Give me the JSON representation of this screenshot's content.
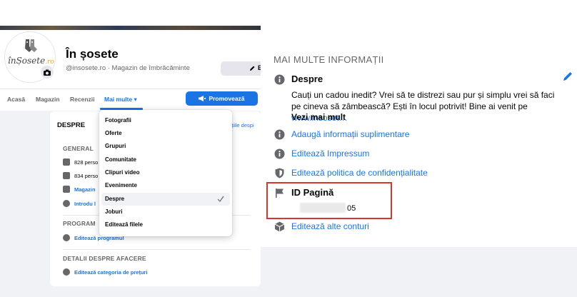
{
  "left": {
    "page": {
      "name": "În șosete",
      "handle": "@insosete.ro · Magazin de îmbrăcăminte",
      "logo_text": "înȘosete",
      "logo_suffix": ".ro",
      "edit_label": "E"
    },
    "tabs": [
      {
        "label": "Acasă"
      },
      {
        "label": "Magazin"
      },
      {
        "label": "Recenzii"
      },
      {
        "label": "Mai multe ▾"
      }
    ],
    "promote_label": "Promovează",
    "about": {
      "title": "DESPRE",
      "right_link": "națiile despi",
      "general_head": "GENERAL",
      "general_rows": [
        {
          "label": "828 perso"
        },
        {
          "label": "834 perso"
        },
        {
          "label": "Magazin",
          "link": true
        },
        {
          "label": "Introdu l",
          "link": true
        }
      ],
      "program_head": "PROGRAM",
      "program_row": "Editează programul",
      "business_head": "DETALII DESPRE AFACERE",
      "business_row": "Editează categoria de prețuri"
    },
    "dropdown": {
      "items": [
        {
          "label": "Fotografii"
        },
        {
          "label": "Oferte"
        },
        {
          "label": "Grupuri"
        },
        {
          "label": "Comunitate"
        },
        {
          "label": "Clipuri video"
        },
        {
          "label": "Evenimente"
        },
        {
          "label": "Despre",
          "selected": true
        },
        {
          "label": "Joburi"
        },
        {
          "label": "Editează filele"
        }
      ]
    }
  },
  "right": {
    "heading": "MAI MULTE INFORMAȚII",
    "about_title": "Despre",
    "description": "Cauți un cadou inedit? Vrei să te distrezi sau pur și simplu vrei să faci pe cineva să zâmbească? Ești în locul potrivit! Bine ai venit pe",
    "description_link": "www.insoset…",
    "see_more": "Vezi mai mult",
    "links": [
      {
        "label": "Adaugă informații suplimentare",
        "icon": "info-icon"
      },
      {
        "label": "Editează Impressum",
        "icon": "info-icon"
      },
      {
        "label": "Editează politica de confidențialitate",
        "icon": "shield-icon"
      }
    ],
    "page_id_title": "ID Pagină",
    "page_id_value": "05",
    "other_accounts": "Editează alte conturi",
    "colors": {
      "accent": "#1b74e4",
      "highlight": "#d5372b",
      "icon": "#65676b"
    }
  }
}
